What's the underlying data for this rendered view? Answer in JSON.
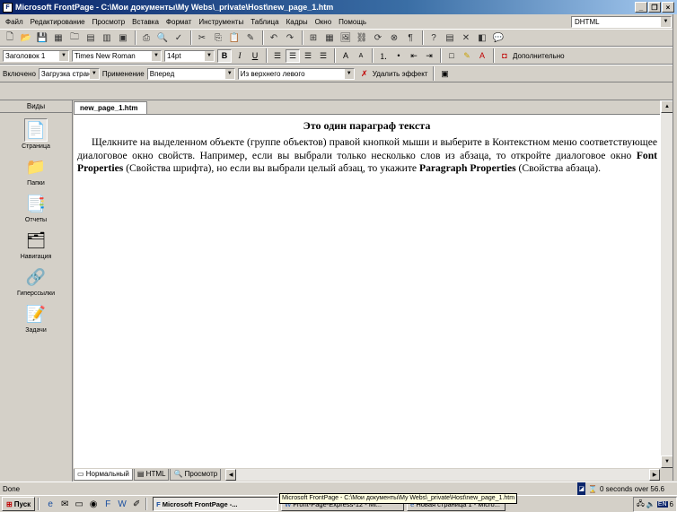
{
  "window": {
    "title": "Microsoft FrontPage - C:\\Мои документы\\My Webs\\_private\\Host\\new_page_1.htm"
  },
  "menu": [
    "Файл",
    "Редактирование",
    "Просмотр",
    "Вставка",
    "Формат",
    "Инструменты",
    "Таблица",
    "Кадры",
    "Окно",
    "Помощь"
  ],
  "dhtml_box": "DHTML",
  "format_toolbar": {
    "style": "Заголовок 1",
    "font": "Times New Roman",
    "size": "14pt",
    "more": "Дополнительно"
  },
  "dhtml_toolbar": {
    "on_label": "Включено",
    "event": "Загрузка страни",
    "apply_label": "Применение",
    "effect": "Вперед",
    "direction": "Из верхнего левого",
    "remove": "Удалить эффект"
  },
  "views": {
    "header": "Виды",
    "items": [
      "Страница",
      "Папки",
      "Отчеты",
      "Навигация",
      "Гиперссылки",
      "Задачи"
    ]
  },
  "document": {
    "tab": "new_page_1.htm",
    "heading": "Это один параграф текста",
    "p1": "Щелкните на выделенном объекте (группе объектов) правой кнопкой мыши и выберите в Контекстном меню соответствующее диалоговое окно свойств. Например, если вы выбрали только несколько слов из абзаца, то откройте диалоговое окно ",
    "b1": "Font Properties",
    "p2": " (Свойства шрифта), но если вы выбрали целый абзац, то укажите ",
    "b2": "Paragraph Properties",
    "p3": " (Свойства абзаца)."
  },
  "view_tabs": [
    "Нормальный",
    "HTML",
    "Просмотр"
  ],
  "status": {
    "left": "Done",
    "right": "0 seconds over 56.6"
  },
  "tooltip": "Microsoft FrontPage - C:\\Мои документы\\My Webs\\_private\\Host\\new_page_1.htm",
  "taskbar": {
    "start": "Пуск",
    "items": [
      "Microsoft FrontPage -...",
      "Front-Page-Express-12 - Mi...",
      "Новая страница 1 - Micro..."
    ],
    "lang": "EN",
    "clock": "6"
  }
}
